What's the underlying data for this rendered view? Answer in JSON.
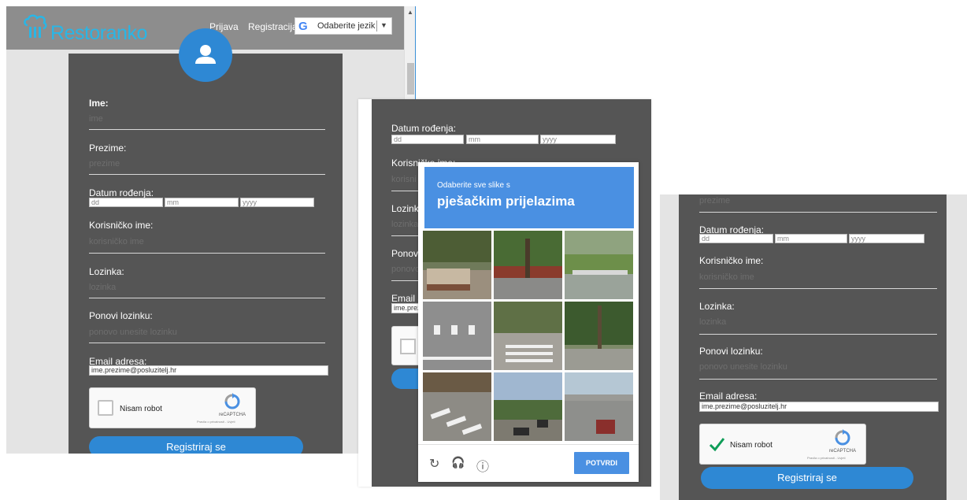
{
  "panel1": {
    "brand": "Restoranko",
    "nav": {
      "login": "Prijava",
      "register": "Registracija"
    },
    "language_select": {
      "icon": "google-g-icon",
      "letter": "G",
      "value": "Odaberite jezik",
      "arrow": "▼"
    },
    "scroll_up": "▲",
    "fields": {
      "first_name_label": "Ime:",
      "first_name_placeholder": "ime",
      "last_name_label": "Prezime:",
      "last_name_placeholder": "prezime",
      "dob_label": "Datum rođenja:",
      "dob_day": "dd",
      "dob_month": "mm",
      "dob_year": "yyyy",
      "username_label": "Korisničko ime:",
      "username_placeholder": "korisničko ime",
      "password_label": "Lozinka:",
      "password_placeholder": "lozinka",
      "repeat_label": "Ponovi lozinku:",
      "repeat_placeholder": "ponovo unesite lozinku",
      "email_label": "Email adresa:",
      "email_value": "ime.prezime@posluzitelj.hr"
    },
    "captcha": {
      "label": "Nisam robot",
      "brand": "reCAPTCHA",
      "links": "Pravila o privatnosti - Uvjeti"
    },
    "submit": "Registriraj se"
  },
  "panel2": {
    "dob_label": "Datum rođenja:",
    "dob_day": "dd",
    "dob_month": "mm",
    "dob_year": "yyyy",
    "username_label_partial": "Korisničko ime:",
    "username_ph_partial": "korisni",
    "password_label_partial": "Lozinka",
    "password_ph_partial": "lozinka",
    "repeat_label_partial": "Ponovi",
    "repeat_ph_partial": "ponovo",
    "email_label_partial": "Email a",
    "email_value_partial": "ime.prez",
    "challenge": {
      "instruction": "Odaberite sve slike s",
      "target": "pješačkim prijelazima",
      "verify": "POTVRDI",
      "icons": {
        "reload": "↻",
        "audio": "🎧",
        "info": "ⓘ"
      }
    }
  },
  "panel3": {
    "last_name_placeholder": "prezime",
    "dob_label": "Datum rođenja:",
    "dob_day": "dd",
    "dob_month": "mm",
    "dob_year": "yyyy",
    "username_label": "Korisničko ime:",
    "username_placeholder": "korisničko ime",
    "password_label": "Lozinka:",
    "password_placeholder": "lozinka",
    "repeat_label": "Ponovi lozinku:",
    "repeat_placeholder": "ponovo unesite lozinku",
    "email_label": "Email adresa:",
    "email_value": "ime.prezime@posluzitelj.hr",
    "captcha": {
      "label": "Nisam robot",
      "brand": "reCAPTCHA",
      "links": "Pravila o privatnosti - Uvjeti",
      "checked": true
    },
    "submit": "Registriraj se"
  },
  "colors": {
    "accent": "#2e88d4",
    "brand_text": "#29b6e6",
    "form_bg": "#555555",
    "captcha_blue": "#4a90e2",
    "check_green": "#0f9d58"
  }
}
